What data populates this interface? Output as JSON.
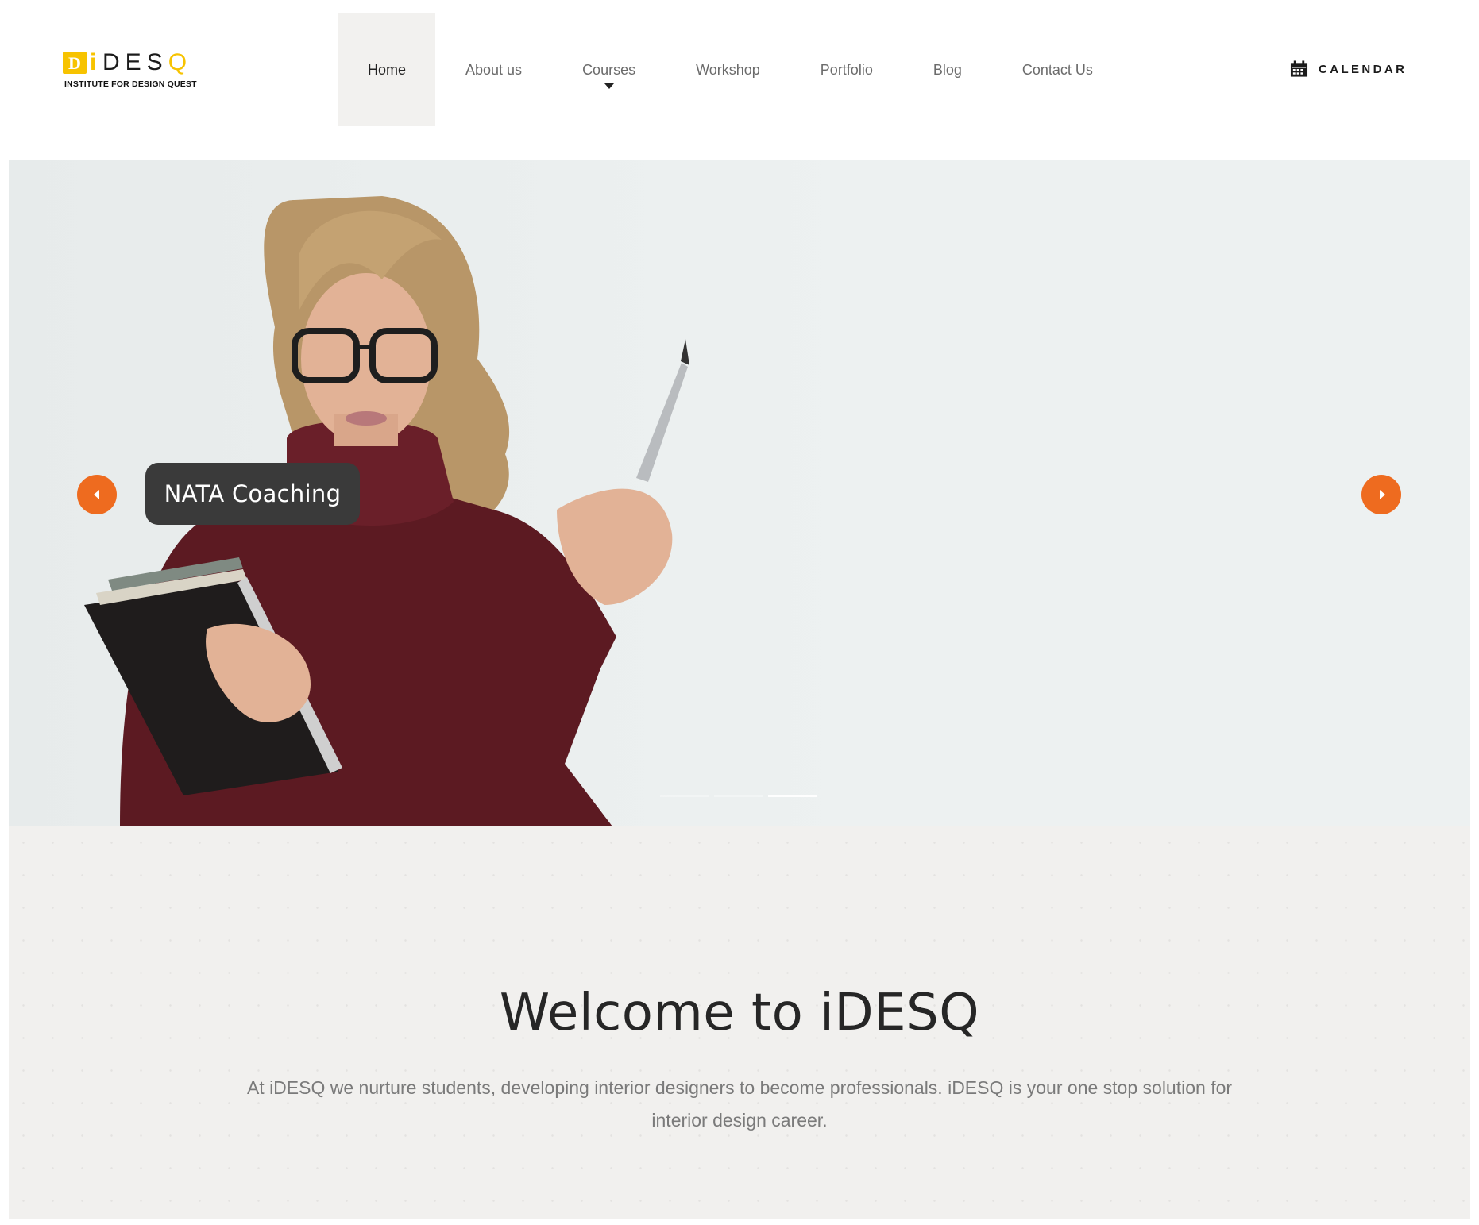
{
  "brand": {
    "logo_mark": "D",
    "logo_i": "i",
    "logo_word_main": "DES",
    "logo_word_q": "Q",
    "tagline": "INSTITUTE FOR DESIGN QUEST",
    "primary_color": "#f7c300"
  },
  "nav": {
    "items": [
      {
        "label": "Home",
        "active": true
      },
      {
        "label": "About us"
      },
      {
        "label": "Courses",
        "has_dropdown": true
      },
      {
        "label": "Workshop"
      },
      {
        "label": "Portfolio"
      },
      {
        "label": "Blog"
      },
      {
        "label": "Contact Us"
      }
    ],
    "calendar_label": "CALENDAR",
    "calendar_icon": "calendar-icon"
  },
  "hero": {
    "slide_label": "NATA Coaching",
    "prev_icon": "chevron-left-icon",
    "next_icon": "chevron-right-icon",
    "accent_color": "#ee6b1f",
    "slide_count": 3,
    "active_slide": 3
  },
  "welcome": {
    "title": "Welcome to iDESQ",
    "text": "At iDESQ we nurture students, developing interior designers to become professionals. iDESQ is your one stop solution for interior design career."
  }
}
